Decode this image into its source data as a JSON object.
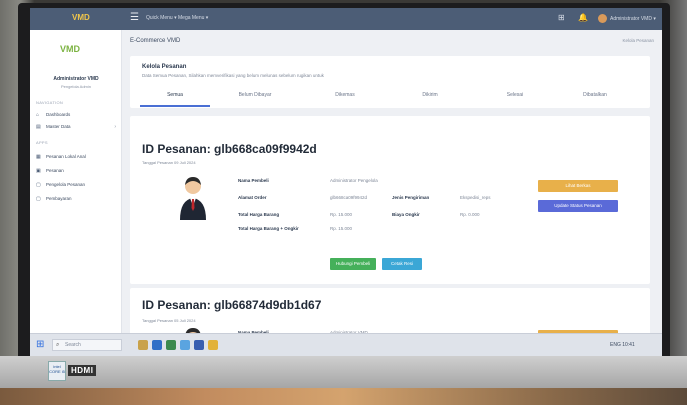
{
  "topnav": {
    "logo": "VMD",
    "menu_items": [
      "Quick Menu ▾",
      "Mega Menu ▾"
    ],
    "user": "Administrator VMD ▾"
  },
  "sidebar": {
    "logo": "VMD",
    "name": "Administrator VMD",
    "role": "Pengelola Admin",
    "section_main": "NAVIGATION",
    "items_main": [
      {
        "label": "Dashboards",
        "icon": "home-icon"
      },
      {
        "label": "Master Data",
        "icon": "database-icon"
      }
    ],
    "section_apps": "APPS",
    "items_apps": [
      {
        "label": "Pesanan Lokal Anal",
        "icon": "list-icon"
      },
      {
        "label": "Pesanan",
        "icon": "cart-icon"
      },
      {
        "label": "Pengelola Pesanan",
        "icon": "box-icon"
      },
      {
        "label": "Pembayaran",
        "icon": "wallet-icon"
      }
    ]
  },
  "header": {
    "title": "E-Commerce VMD",
    "breadcrumb": "Kelola Pesanan"
  },
  "orders_card": {
    "title": "Kelola Pesanan",
    "subtitle": "Data Semua Pesanan, Silahkan memverifikasi yang belum melunas sebelum rugikan untuk",
    "tabs": [
      "Semua",
      "Belum Dibayar",
      "Dikemas",
      "Dikirim",
      "Selesai",
      "Dibatalkan"
    ]
  },
  "order1": {
    "id": "ID Pesanan: glb668ca09f9942d",
    "date": "Tanggal Pesanan 09 Juli 2024",
    "fields": [
      {
        "label": "Nama Pembeli",
        "value": "Administrator Pengelola"
      },
      {
        "label": "Alamat Order",
        "value": "glb668ca09f9942d"
      },
      {
        "label": "Total Harga Barang",
        "value": "Rp. 15.000"
      },
      {
        "label": "Total Harga Barang + Ongkir",
        "value": "Rp. 15.000"
      }
    ],
    "side_fields": [
      {
        "label": "Jenis Pengiriman",
        "value": "Ekspedisi_reps"
      },
      {
        "label": "Biaya Ongkir",
        "value": "Rp. 0.000"
      }
    ],
    "btn_primary": "Lihat Berkas",
    "btn_status": "Update Status Pesanan",
    "btn_detail": "Hubungi Pembeli",
    "btn_print": "Cetak Resi"
  },
  "order2": {
    "id": "ID Pesanan: glb66874d9db1d67",
    "date": "Tanggal Pesanan 05 Juli 2024",
    "fields": [
      {
        "label": "Nama Pembeli",
        "value": "Administrator VMD"
      }
    ],
    "btn_primary": "Lihat Berkas"
  },
  "taskbar": {
    "search_placeholder": "Search",
    "tray": "ENG  10:41"
  },
  "monitor": {
    "sticker": "intel CORE i5",
    "port_label": "HDMI"
  },
  "colors": {
    "topnav": "#4c5d76",
    "btn_yellow": "#e8b04a",
    "btn_blue": "#5a6ad8",
    "btn_green": "#45b05a",
    "btn_cyan": "#3ba7d6",
    "tab_active": "#4a6fd4"
  }
}
